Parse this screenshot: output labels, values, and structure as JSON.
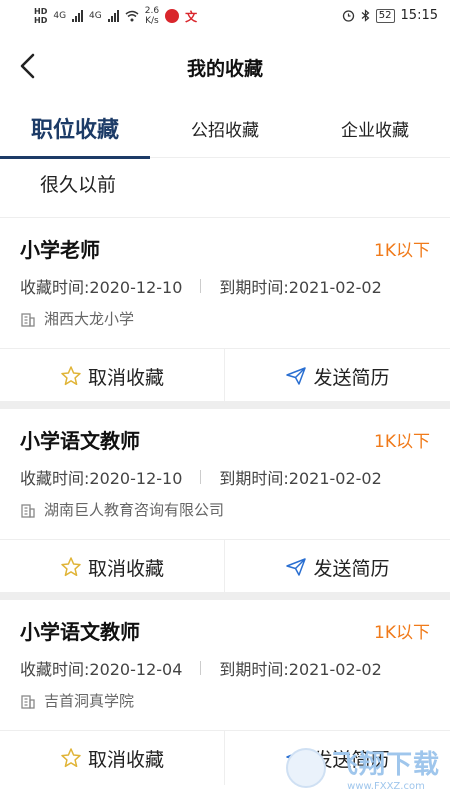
{
  "status_bar": {
    "hd_top": "HD",
    "hd_bottom": "HD",
    "net1": "4G",
    "net2": "4G",
    "speed_value": "2.6",
    "speed_unit": "K/s",
    "app_icon2": "文",
    "battery": "52",
    "time": "15:15"
  },
  "nav": {
    "title": "我的收藏"
  },
  "tabs": [
    {
      "label": "职位收藏"
    },
    {
      "label": "公招收藏"
    },
    {
      "label": "企业收藏"
    }
  ],
  "section_header": "很久以前",
  "cards": [
    {
      "title": "小学老师",
      "salary": "1K以下",
      "collect_time": "收藏时间:2020-12-10",
      "expire_time": "到期时间:2021-02-02",
      "company": "湘西大龙小学",
      "cancel_label": "取消收藏",
      "send_label": "发送简历"
    },
    {
      "title": "小学语文教师",
      "salary": "1K以下",
      "collect_time": "收藏时间:2020-12-10",
      "expire_time": "到期时间:2021-02-02",
      "company": "湖南巨人教育咨询有限公司",
      "cancel_label": "取消收藏",
      "send_label": "发送简历"
    },
    {
      "title": "小学语文教师",
      "salary": "1K以下",
      "collect_time": "收藏时间:2020-12-04",
      "expire_time": "到期时间:2021-02-02",
      "company": "吉首洞真学院",
      "cancel_label": "取消收藏",
      "send_label": "发送简历"
    }
  ],
  "icons": {
    "back": "chevron-left-icon",
    "building": "building-icon",
    "star": "star-outline-icon",
    "send": "paper-plane-icon"
  },
  "colors": {
    "accent": "#1c3b67",
    "salary": "#f07a1a",
    "star": "#e0b437",
    "send": "#2a6fd1"
  },
  "watermark": {
    "text": "飞翔下载",
    "url_text": "www.FXXZ.com"
  }
}
